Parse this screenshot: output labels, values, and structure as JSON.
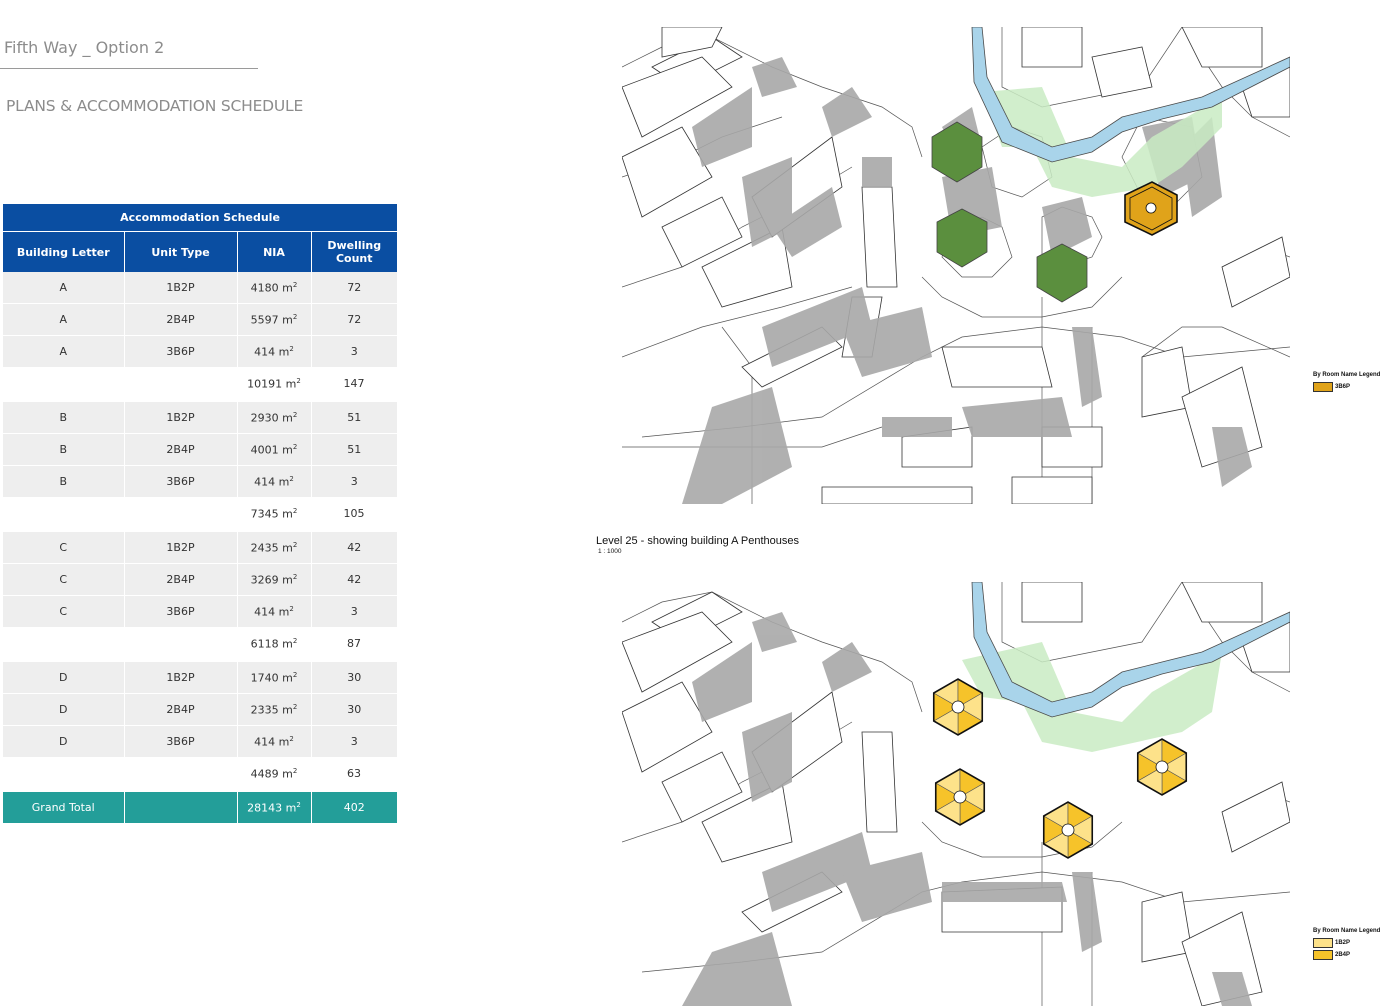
{
  "header": {
    "title": "Fifth Way _ Option 2",
    "subtitle": "PLANS & ACCOMMODATION SCHEDULE"
  },
  "schedule": {
    "title": "Accommodation Schedule",
    "columns": [
      "Building Letter",
      "Unit Type",
      "NIA",
      "Dwelling Count"
    ],
    "groups": [
      {
        "rows": [
          [
            "A",
            "1B2P",
            "4180 m",
            "72"
          ],
          [
            "A",
            "2B4P",
            "5597 m",
            "72"
          ],
          [
            "A",
            "3B6P",
            "414 m",
            "3"
          ]
        ],
        "subtotal": [
          "10191 m",
          "147"
        ]
      },
      {
        "rows": [
          [
            "B",
            "1B2P",
            "2930 m",
            "51"
          ],
          [
            "B",
            "2B4P",
            "4001 m",
            "51"
          ],
          [
            "B",
            "3B6P",
            "414 m",
            "3"
          ]
        ],
        "subtotal": [
          "7345 m",
          "105"
        ]
      },
      {
        "rows": [
          [
            "C",
            "1B2P",
            "2435 m",
            "42"
          ],
          [
            "C",
            "2B4P",
            "3269 m",
            "42"
          ],
          [
            "C",
            "3B6P",
            "414 m",
            "3"
          ]
        ],
        "subtotal": [
          "6118 m",
          "87"
        ]
      },
      {
        "rows": [
          [
            "D",
            "1B2P",
            "1740 m",
            "30"
          ],
          [
            "D",
            "2B4P",
            "2335 m",
            "30"
          ],
          [
            "D",
            "3B6P",
            "414 m",
            "3"
          ]
        ],
        "subtotal": [
          "4489 m",
          "63"
        ]
      }
    ],
    "area_unit_exponent": "2",
    "grand_total": {
      "label": "Grand Total",
      "nia": "28143 m",
      "count": "402"
    }
  },
  "plans": {
    "top": {
      "legend_title": "By Room Name Legend",
      "legend_items": [
        {
          "label": "3B6P",
          "color": "#e0a31a"
        }
      ]
    },
    "bottom": {
      "caption": "Level 25 - showing building A Penthouses",
      "scale": "1 : 1000",
      "legend_title": "By Room Name Legend",
      "legend_items": [
        {
          "label": "1B2P",
          "color": "#fde28a"
        },
        {
          "label": "2B4P",
          "color": "#f6c32a"
        }
      ]
    }
  },
  "colors": {
    "header_blue": "#0a4ea2",
    "grand_total_teal": "#239e99",
    "row_grey": "#eeeeee",
    "green_space": "#c9ebc3",
    "tower_green": "#5b8f3e",
    "river": "#a9d4ea",
    "shadow": "#a8a8a8"
  }
}
